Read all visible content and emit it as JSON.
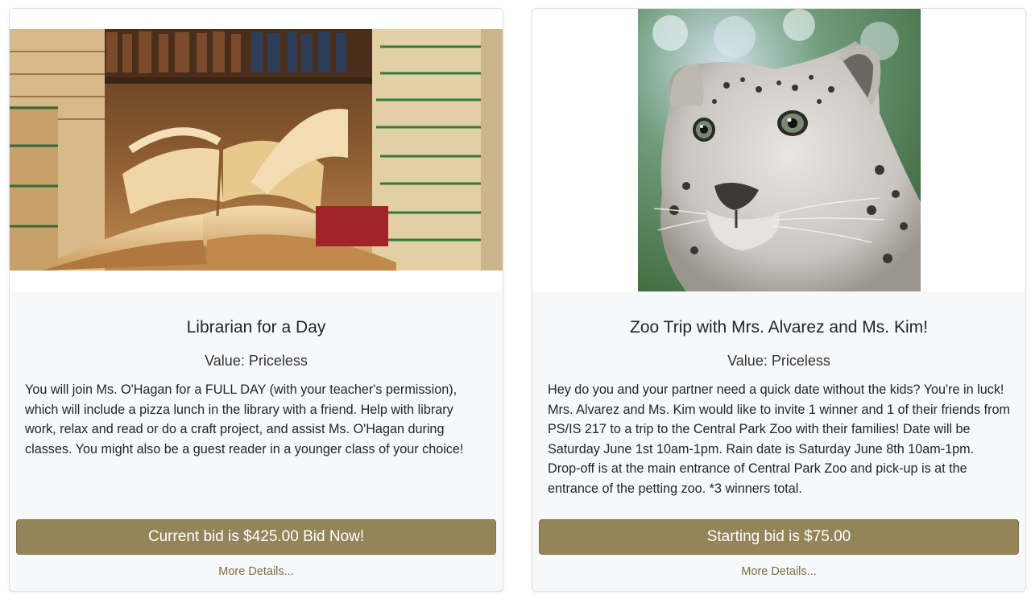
{
  "cards": [
    {
      "image_icon": "books-photo",
      "title": "Librarian for a Day",
      "value": "Value: Priceless",
      "description": "You will join Ms. O'Hagan for a FULL DAY (with your teacher's permission), which will include a pizza lunch in the library with a friend. Help with library work, relax and read or do a craft project, and assist Ms. O'Hagan during classes. You might also be a guest reader in a younger class of your choice!",
      "bid_button": "Current bid is $425.00 Bid Now!",
      "more_link": "More Details..."
    },
    {
      "image_icon": "snow-leopard-photo",
      "title": "Zoo Trip with Mrs. Alvarez and Ms. Kim!",
      "value": "Value: Priceless",
      "description": "Hey do you and your partner need a quick date without the kids? You're in luck! Mrs. Alvarez and Ms. Kim would like to invite 1 winner and 1 of their friends from PS/IS 217 to a trip to the Central Park Zoo with their families! Date will be Saturday June 1st 10am-1pm. Rain date is Saturday June 8th 10am-1pm. Drop-off is at the main entrance of Central Park Zoo and pick-up is at the entrance of the petting zoo. *3 winners total.",
      "bid_button": "Starting bid is $75.00",
      "more_link": "More Details..."
    }
  ],
  "colors": {
    "button_bg": "#93845a",
    "link": "#7b6c44",
    "card_bg": "#f7f8fa"
  }
}
